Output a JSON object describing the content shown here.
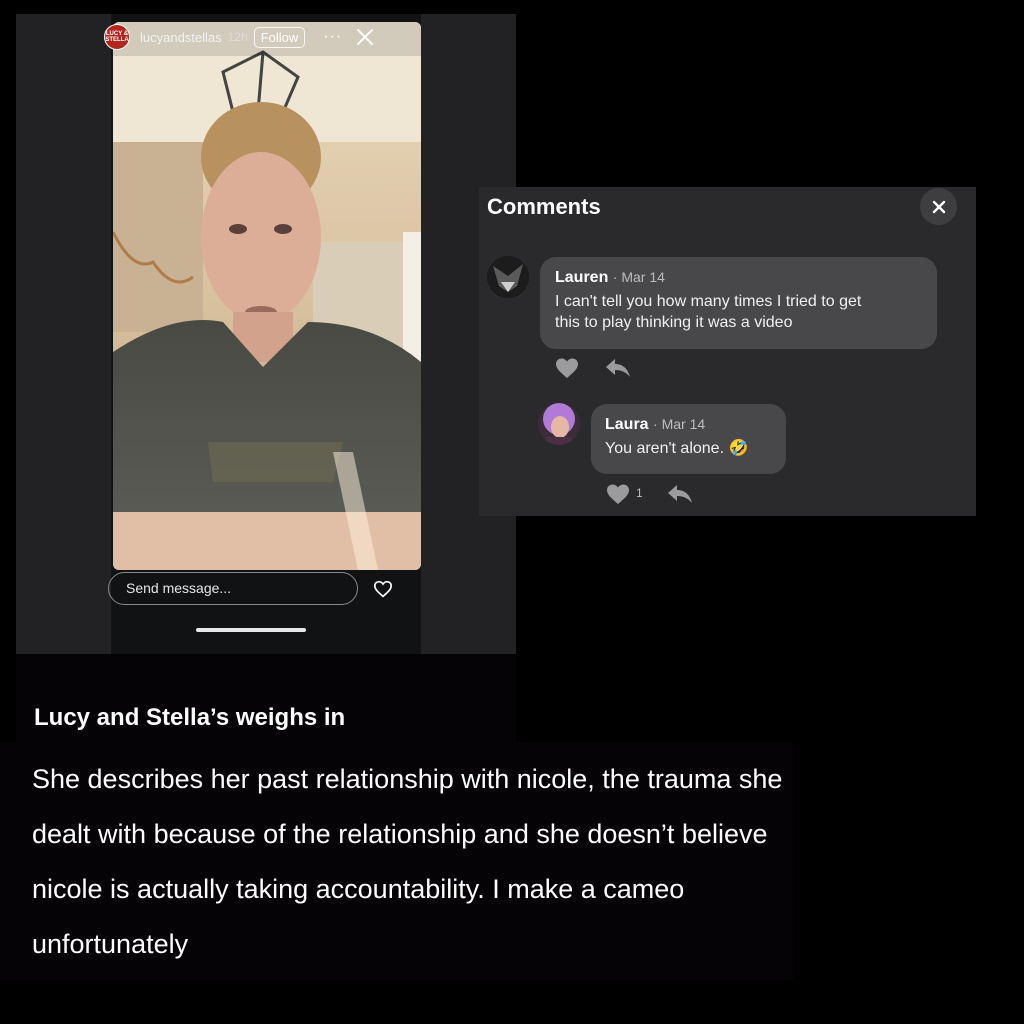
{
  "story": {
    "avatar_text": "LUCY & STELLA",
    "username": "lucyandstellas",
    "time": "12h",
    "follow_label": "Follow",
    "more_symbol": "···",
    "message_placeholder": "Send message..."
  },
  "comments": {
    "title": "Comments",
    "close_symbol": "×",
    "items": [
      {
        "name": "Lauren",
        "date": "· Mar 14",
        "text_line1": "I can't tell you how many times I tried to get",
        "text_line2": "this to play thinking it was a video"
      },
      {
        "name": "Laura",
        "date": "· Mar 14",
        "text": "You aren't alone.",
        "emoji": "🤣",
        "like_count": "1"
      }
    ]
  },
  "article": {
    "heading": "Lucy and Stella’s weighs in",
    "body": "She describes her past relationship with nicole, the trauma she dealt with because of the relationship and she doesn’t believe nicole is actually taking accountability. I make a cameo unfortunately"
  },
  "colors": {
    "page_bg": "#000000",
    "panel_bg": "#2a2a2c",
    "bubble_bg": "#48484b",
    "story_bg": "#222224"
  },
  "icons": [
    "close-icon",
    "more-icon",
    "heart-icon",
    "reply-icon"
  ]
}
